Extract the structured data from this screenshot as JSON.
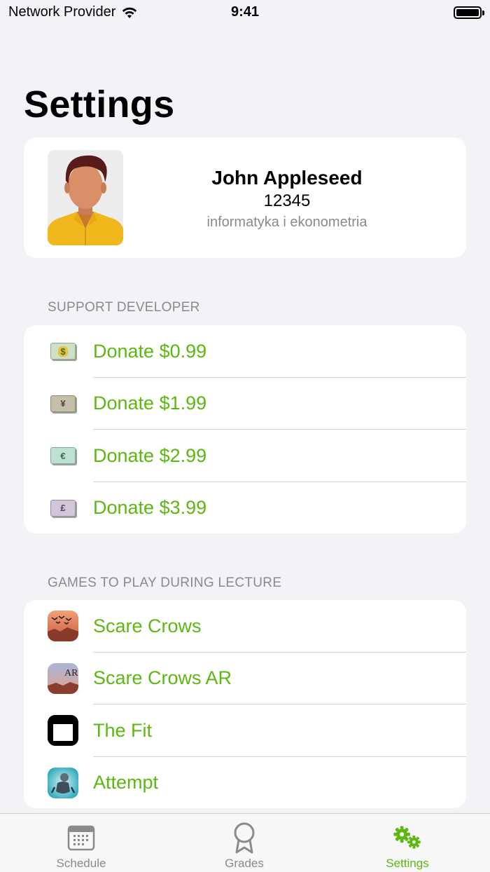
{
  "status_bar": {
    "carrier": "Network Provider",
    "time": "9:41"
  },
  "page_title": "Settings",
  "profile": {
    "name": "John Appleseed",
    "id": "12345",
    "major": "informatyka i ekonometria"
  },
  "support": {
    "header": "SUPPORT DEVELOPER",
    "items": [
      {
        "label": "Donate $0.99",
        "icon": "dollar-banknote-icon"
      },
      {
        "label": "Donate $1.99",
        "icon": "yen-banknote-icon"
      },
      {
        "label": "Donate $2.99",
        "icon": "euro-banknote-icon"
      },
      {
        "label": "Donate $3.99",
        "icon": "pound-banknote-icon"
      }
    ]
  },
  "games": {
    "header": "GAMES TO PLAY DURING LECTURE",
    "items": [
      {
        "label": "Scare Crows",
        "icon": "scare-crows-app-icon"
      },
      {
        "label": "Scare Crows AR",
        "icon": "scare-crows-ar-app-icon"
      },
      {
        "label": "The Fit",
        "icon": "the-fit-app-icon"
      },
      {
        "label": "Attempt",
        "icon": "attempt-app-icon"
      }
    ]
  },
  "tabs": [
    {
      "label": "Schedule",
      "icon": "calendar-icon",
      "active": false
    },
    {
      "label": "Grades",
      "icon": "award-ribbon-icon",
      "active": false
    },
    {
      "label": "Settings",
      "icon": "gears-icon",
      "active": true
    }
  ],
  "colors": {
    "accent": "#5cb811",
    "background": "#f2f2f7",
    "secondary_text": "#8a8a8e"
  }
}
